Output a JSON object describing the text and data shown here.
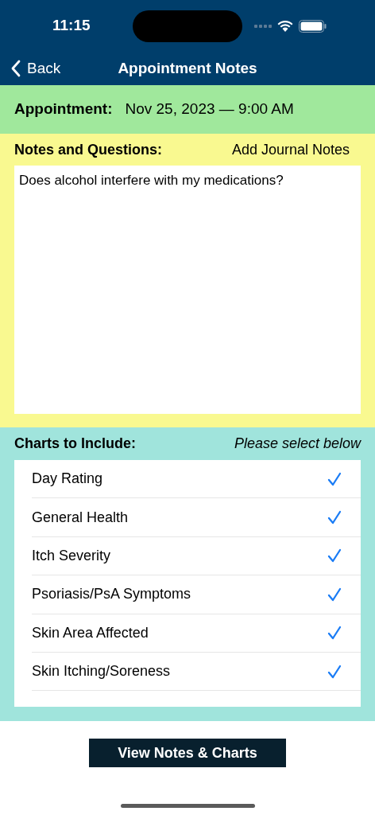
{
  "status_bar": {
    "time": "11:15"
  },
  "nav": {
    "back": "Back",
    "title": "Appointment Notes"
  },
  "appointment": {
    "label": "Appointment:",
    "value": "Nov 25, 2023 — 9:00 AM"
  },
  "notes": {
    "label": "Notes and Questions:",
    "action": "Add Journal Notes",
    "value": "Does alcohol interfere with my medications?"
  },
  "charts": {
    "label": "Charts to Include:",
    "hint": "Please select below",
    "items": [
      {
        "label": "Day Rating",
        "checked": true
      },
      {
        "label": "General Health",
        "checked": true
      },
      {
        "label": "Itch Severity",
        "checked": true
      },
      {
        "label": "Psoriasis/PsA Symptoms",
        "checked": true
      },
      {
        "label": "Skin Area Affected",
        "checked": true
      },
      {
        "label": "Skin Itching/Soreness",
        "checked": true
      }
    ]
  },
  "button": "View Notes & Charts"
}
